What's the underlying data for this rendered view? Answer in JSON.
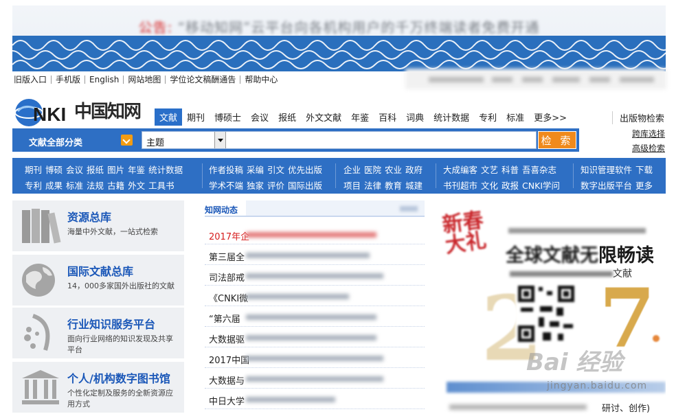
{
  "banner": {
    "notice_label": "公告:",
    "notice_text": "“移动知网”云平台向各机构用户的千万终端读者免费开通"
  },
  "toplinks": [
    "旧版入口",
    "手机版",
    "English",
    "网站地图",
    "学位论文稿酬通告",
    "帮助中心"
  ],
  "logo": {
    "brand": "CNKI",
    "chinese": "中国知网"
  },
  "navtabs": [
    "文献",
    "期刊",
    "博硕士",
    "会议",
    "报纸",
    "外文文献",
    "年鉴",
    "百科",
    "词典",
    "统计数据",
    "专利",
    "标准",
    "更多>>"
  ],
  "active_tab": "文献",
  "rightlinks": {
    "pub_search": "出版物检索",
    "cross_lib": "跨库选择",
    "advanced": "高级检索"
  },
  "search": {
    "category": "文献全部分类",
    "field": "主题",
    "keyword": "",
    "button": "检 索"
  },
  "catbar": {
    "g1": {
      "r1": [
        "期刊",
        "博硕",
        "会议",
        "报纸",
        "图片",
        "年鉴",
        "统计数据"
      ],
      "r2": [
        "专利",
        "成果",
        "标准",
        "法规",
        "古籍",
        "外文",
        "工具书"
      ]
    },
    "g2": {
      "r1": [
        "作者投稿",
        "采编",
        "引文",
        "优先出版"
      ],
      "r2": [
        "学术不端",
        "独家",
        "评价",
        "国际出版"
      ]
    },
    "g3": {
      "r1": [
        "企业",
        "医院",
        "农业",
        "政府"
      ],
      "r2": [
        "项目",
        "法律",
        "教育",
        "城建"
      ]
    },
    "g4": {
      "r1": [
        "大成编客",
        "文艺",
        "科普",
        "吾喜杂志"
      ],
      "r2": [
        "书刊超市",
        "文化",
        "政报",
        "CNKI学问"
      ]
    },
    "g5": {
      "r1": [
        "知识管理软件",
        "下载"
      ],
      "r2": [
        "数字出版平台",
        "更多"
      ]
    }
  },
  "resources": [
    {
      "title": "资源总库",
      "desc": "海量中外文献，一站式检索",
      "icon": "books-icon"
    },
    {
      "title": "国际文献总库",
      "desc": "14，000多家国外出版社的文献",
      "icon": "globe-icon"
    },
    {
      "title": "行业知识服务平台",
      "desc": "面向行业网络的知识发现及共享平台",
      "icon": "network-icon"
    },
    {
      "title": "个人/机构数字图书馆",
      "desc": "个性化定制及服务的全新资源应用方式",
      "icon": "library-icon"
    }
  ],
  "news": {
    "header": "知网动态",
    "items": [
      "2017年企",
      "第三届全",
      "司法部戒",
      "《CNKI微",
      "“第六届",
      "大数据驱",
      "2017中国",
      "大数据与",
      "中日大学"
    ]
  },
  "promo": {
    "title_fragment": "限畅读",
    "sub_fragment": "文献",
    "bottom_fragment": "研讨、创作)"
  },
  "watermark": {
    "text": "Bai 经验",
    "url": "jingyan.baidu.com"
  },
  "colors": {
    "primary": "#2e6fc4",
    "accent": "#f08a1c",
    "link": "#1a57b8",
    "alert": "#d61c1c"
  }
}
